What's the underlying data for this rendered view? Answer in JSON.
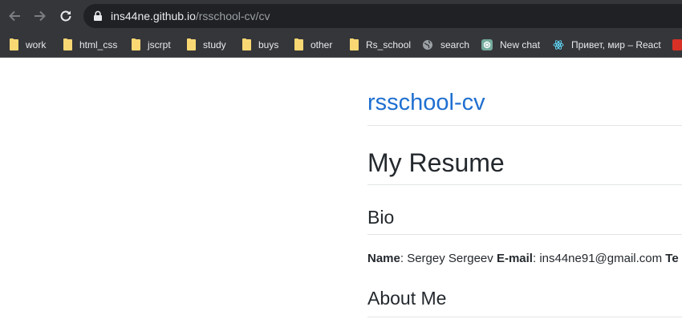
{
  "browser": {
    "url_host": "ins44ne.github.io",
    "url_path": "/rsschool-cv/cv"
  },
  "bookmarks": [
    {
      "label": "work",
      "icon": "folder-icon"
    },
    {
      "label": "html_css",
      "icon": "folder-icon"
    },
    {
      "label": "jscrpt",
      "icon": "folder-icon"
    },
    {
      "label": "study",
      "icon": "folder-icon"
    },
    {
      "label": "buys",
      "icon": "folder-icon"
    },
    {
      "label": "other",
      "icon": "folder-icon"
    },
    {
      "label": "Rs_school",
      "icon": "folder-icon"
    },
    {
      "label": "search",
      "icon": "globe-icon"
    },
    {
      "label": "New chat",
      "icon": "chatgpt-icon"
    },
    {
      "label": "Привет, мир – React",
      "icon": "react-icon"
    }
  ],
  "page": {
    "site_title": "rsschool-cv",
    "heading": "My Resume",
    "bio_heading": "Bio",
    "bio": {
      "name_label": "Name",
      "name_value": "Sergey Sergeev",
      "email_label": "E-mail",
      "email_value": "ins44ne91@gmail.com",
      "next_label": "Te"
    },
    "about_heading": "About Me"
  },
  "colors": {
    "chrome_bg": "#35363a",
    "omnibox_bg": "#202124",
    "link": "#1f6fd1",
    "folder": "#f9d873"
  }
}
